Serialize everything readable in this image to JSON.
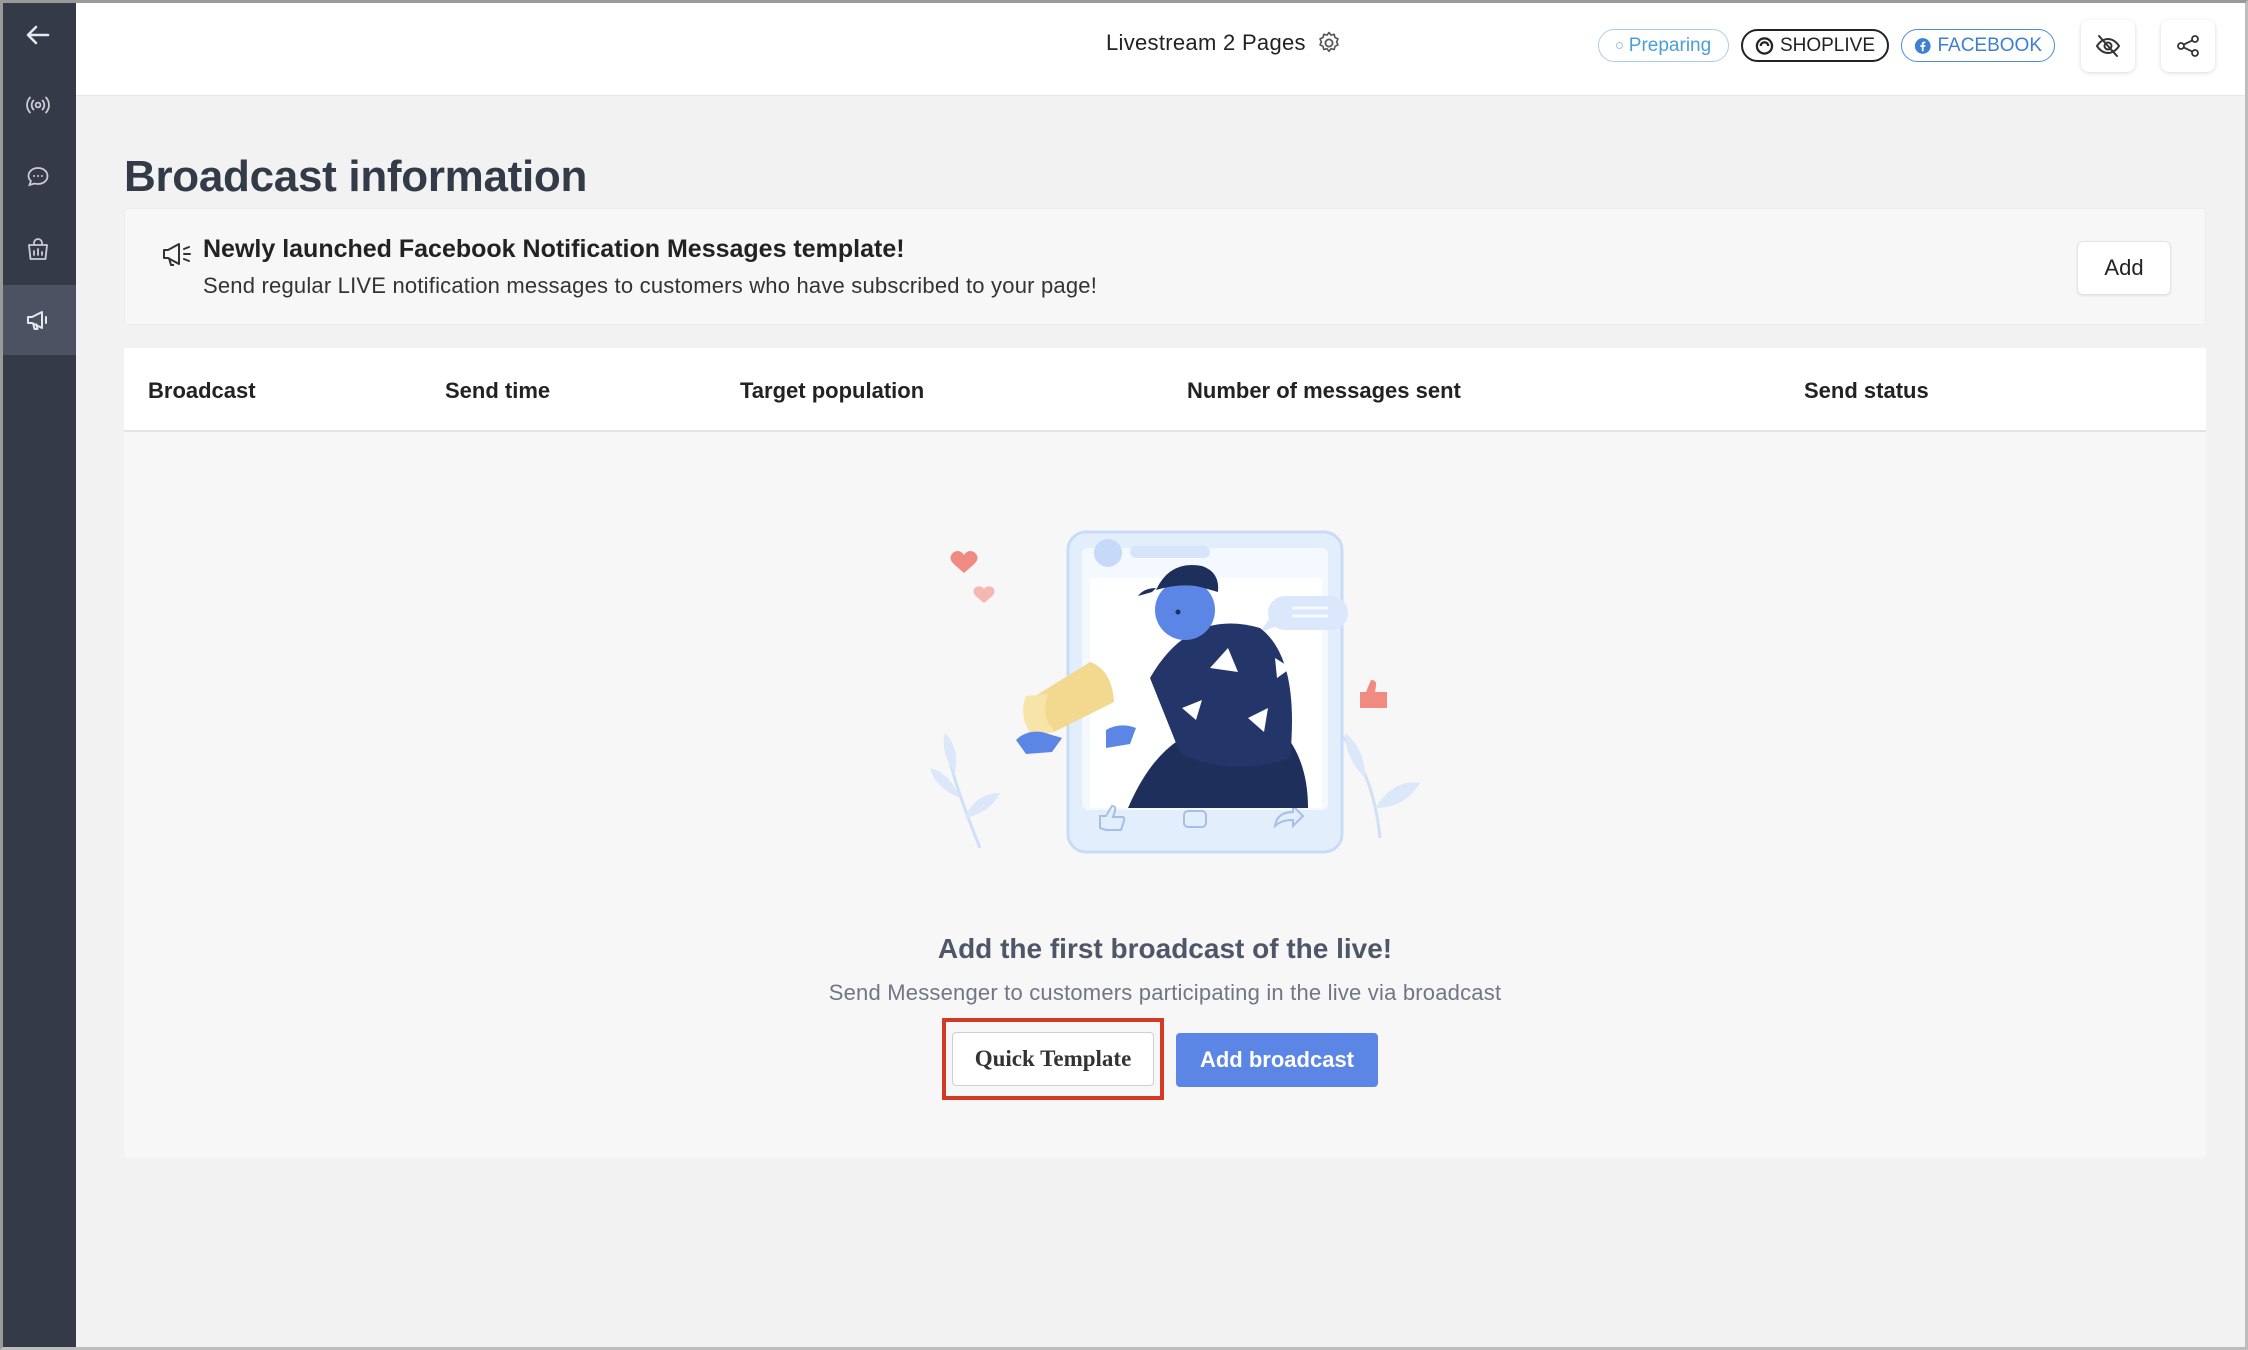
{
  "topbar": {
    "page_title": "Livestream 2 Pages",
    "status_pill": "Preparing",
    "platform_shoplive": "SHOPLIVE",
    "platform_facebook": "FACEBOOK"
  },
  "main": {
    "heading": "Broadcast information",
    "notice": {
      "title": "Newly launched Facebook Notification Messages template!",
      "description": "Send regular LIVE notification messages to customers who have subscribed to your page!",
      "add_label": "Add"
    },
    "table": {
      "columns": [
        "Broadcast",
        "Send time",
        "Target population",
        "Number of messages sent",
        "Send status"
      ]
    },
    "empty_state": {
      "title": "Add the first broadcast of the live!",
      "description": "Send Messenger to customers participating in the live via broadcast",
      "quick_template_label": "Quick Template",
      "add_broadcast_label": "Add broadcast"
    }
  },
  "colors": {
    "sidebar_bg": "#353a48",
    "accent_blue": "#5b86e5",
    "highlight_red": "#d23a26"
  }
}
